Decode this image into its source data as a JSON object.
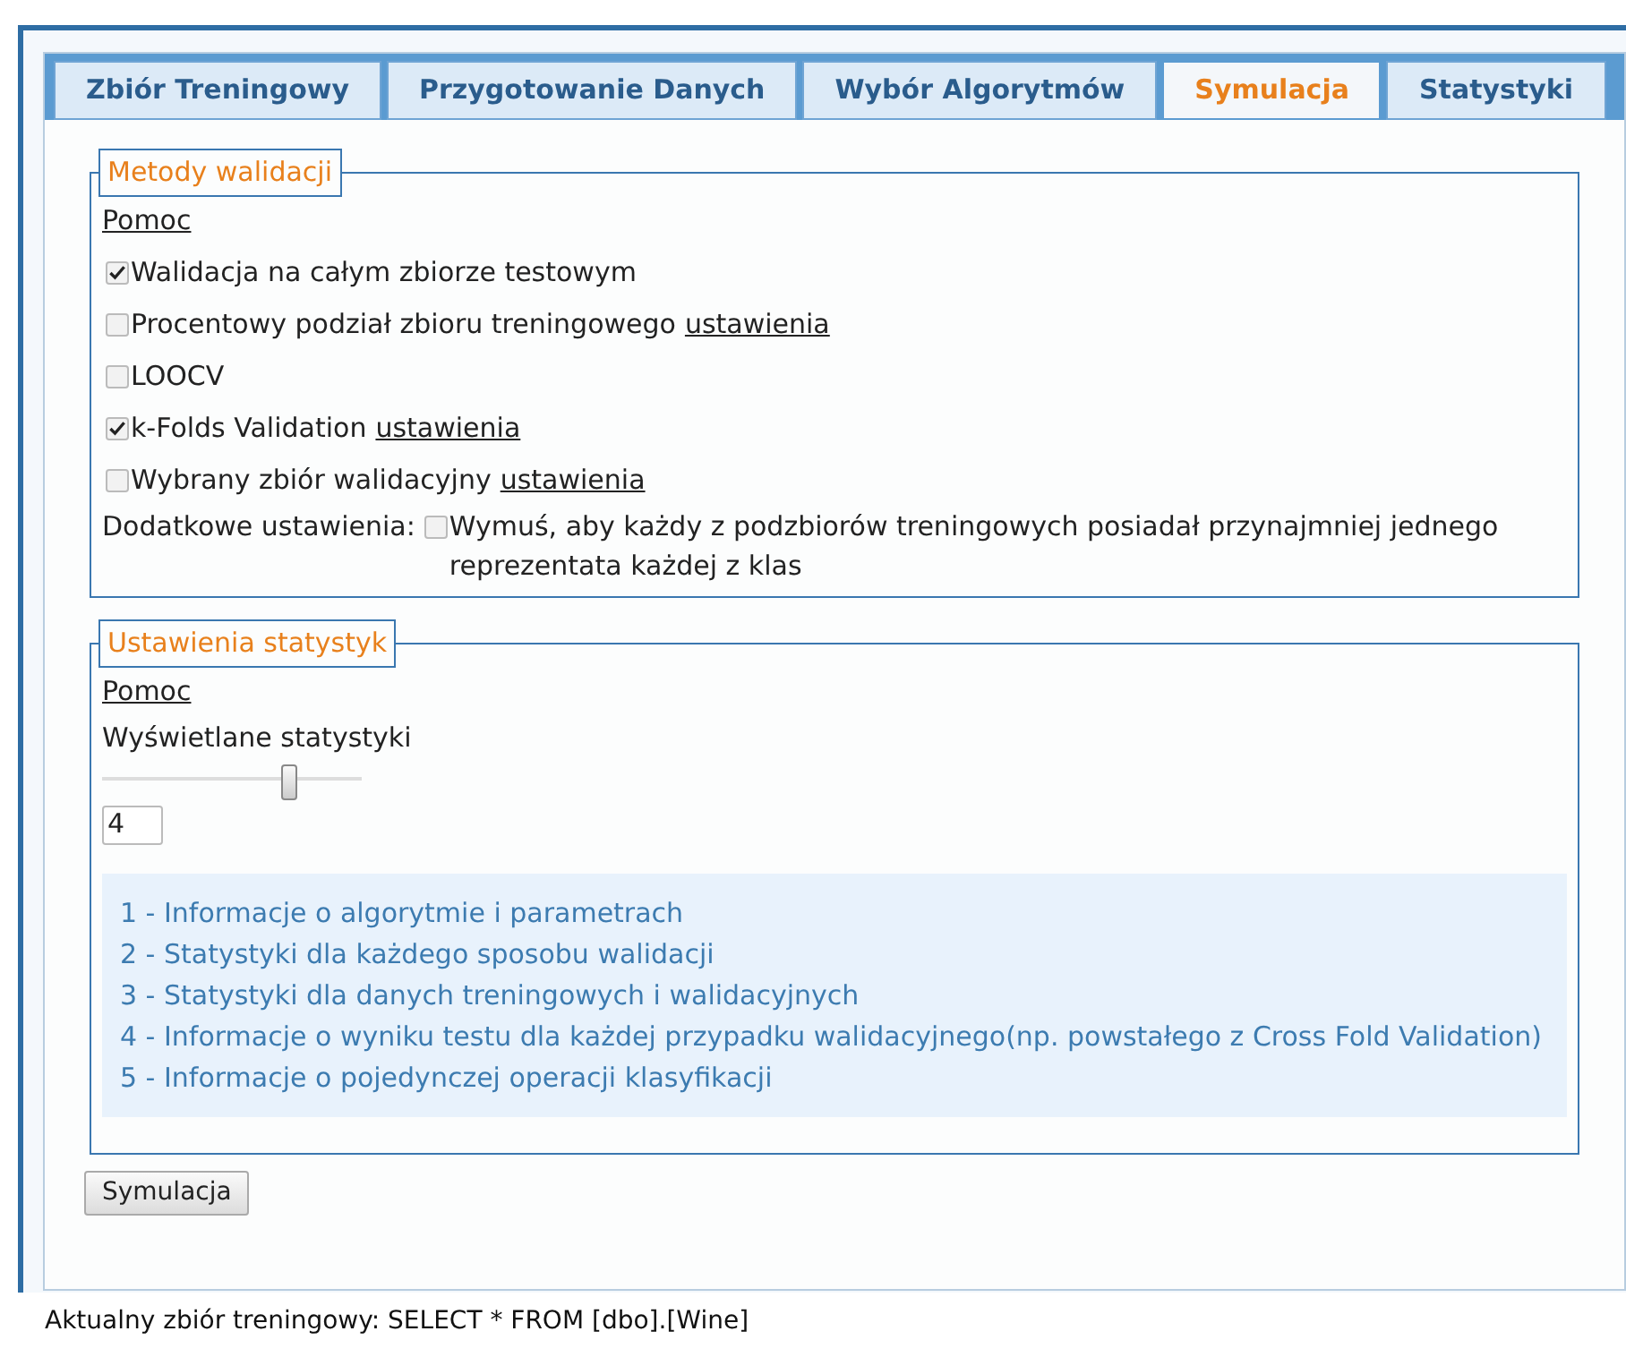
{
  "tabs": [
    {
      "label": "Zbiór Treningowy",
      "selected": false
    },
    {
      "label": "Przygotowanie Danych",
      "selected": false
    },
    {
      "label": "Wybór Algorytmów",
      "selected": false
    },
    {
      "label": "Symulacja",
      "selected": true
    },
    {
      "label": "Statystyki",
      "selected": false
    }
  ],
  "validation": {
    "legend": "Metody walidacji",
    "help": "Pomoc",
    "options": [
      {
        "label": "Walidacja na całym zbiorze testowym",
        "checked": true
      },
      {
        "label": "Procentowy podział zbioru treningowego",
        "checked": false,
        "link": "ustawienia"
      },
      {
        "label": "LOOCV",
        "checked": false
      },
      {
        "label": "k-Folds Validation",
        "checked": true,
        "link": "ustawienia"
      },
      {
        "label": "Wybrany zbiór walidacyjny",
        "checked": false,
        "link": "ustawienia"
      }
    ],
    "extra": {
      "prefix": "Dodatkowe ustawienia:",
      "label": "Wymuś, aby każdy z podzbiorów treningowych posiadał przynajmniej jednego reprezentata każdej z klas",
      "checked": false
    }
  },
  "statistics": {
    "legend": "Ustawienia statystyk",
    "help": "Pomoc",
    "label": "Wyświetlane statystyki",
    "slider": {
      "level": 0.72
    },
    "value": "4",
    "levels": [
      "1 - Informacje o algorytmie i parametrach",
      "2 - Statystyki dla każdego sposobu walidacji",
      "3 - Statystyki dla danych treningowych i walidacyjnych",
      "4 - Informacje o wyniku testu dla każdej przypadku walidacyjnego(np. powstałego z Cross Fold Validation)",
      "5 - Informacje o pojedynczej operacji klasyfikacji"
    ]
  },
  "button": "Symulacja",
  "footer": "Aktualny zbiór treningowy: SELECT * FROM [dbo].[Wine]"
}
